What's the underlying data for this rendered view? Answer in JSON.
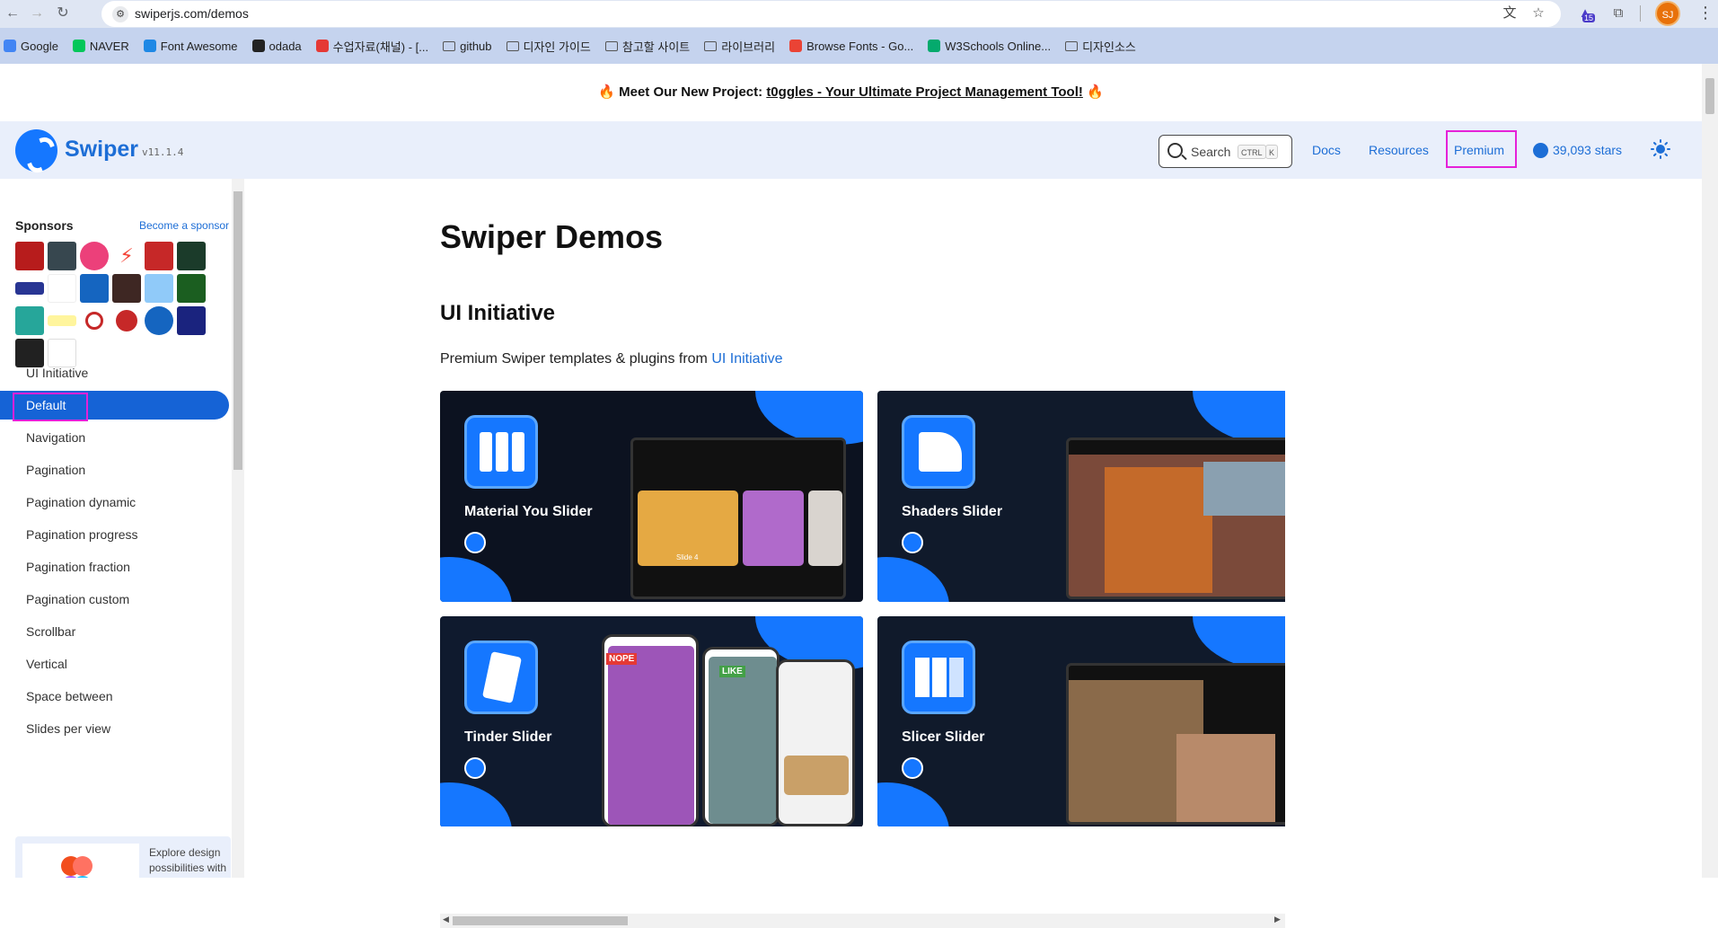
{
  "browser": {
    "url": "swiperjs.com/demos",
    "profile_initials": "SJ",
    "ext_badge": "15",
    "bookmarks": [
      {
        "label": "Google",
        "color": "#4285f4"
      },
      {
        "label": "NAVER",
        "color": "#03c75a"
      },
      {
        "label": "Font Awesome",
        "color": "#1e88e5"
      },
      {
        "label": "odada",
        "color": "#222222"
      },
      {
        "label": "수업자료(채널) - [...",
        "color": "#e53935"
      },
      {
        "label": "github",
        "folder": true
      },
      {
        "label": "디자인 가이드",
        "folder": true
      },
      {
        "label": "참고할 사이트",
        "folder": true
      },
      {
        "label": "라이브러리",
        "folder": true
      },
      {
        "label": "Browse Fonts - Go...",
        "color": "#ea4335"
      },
      {
        "label": "W3Schools Online...",
        "color": "#04aa6d"
      },
      {
        "label": "디자인소스",
        "folder": true
      }
    ]
  },
  "announcement": {
    "prefix": "🔥 Meet Our New Project: ",
    "link": "t0ggles - Your Ultimate Project Management Tool!",
    "suffix": " 🔥"
  },
  "header": {
    "brand": "Swiper",
    "version": "v11.1.4",
    "search_label": "Search",
    "kbd_ctrl": "CTRL",
    "kbd_k": "K",
    "nav": {
      "docs": "Docs",
      "resources": "Resources",
      "premium": "Premium",
      "stars": "39,093 stars"
    }
  },
  "sidebar": {
    "sponsors_title": "Sponsors",
    "become_sponsor": "Become a sponsor",
    "items": [
      {
        "label": "UI Initiative"
      },
      {
        "label": "Default"
      },
      {
        "label": "Navigation"
      },
      {
        "label": "Pagination"
      },
      {
        "label": "Pagination dynamic"
      },
      {
        "label": "Pagination progress"
      },
      {
        "label": "Pagination fraction"
      },
      {
        "label": "Pagination custom"
      },
      {
        "label": "Scrollbar"
      },
      {
        "label": "Vertical"
      },
      {
        "label": "Space between"
      },
      {
        "label": "Slides per view"
      }
    ],
    "active_index": 1,
    "figma_text": "Explore design possibilities with Figma. Build prototypes, and easily translate your"
  },
  "main": {
    "title": "Swiper Demos",
    "section_title": "UI Initiative",
    "intro_text": "Premium Swiper templates & plugins from ",
    "intro_link": "UI Initiative",
    "cards": [
      {
        "title": "Material You Slider",
        "slide_label": "Slide 4"
      },
      {
        "title": "Shaders Slider"
      },
      {
        "title": "Tinder Slider",
        "nope": "NOPE",
        "like": "LIKE"
      },
      {
        "title": "Slicer Slider"
      }
    ]
  },
  "colors": {
    "accent": "#1577ff",
    "link": "#1d6ed6",
    "highlight": "#e521d8",
    "header_bg": "#e9effb"
  }
}
